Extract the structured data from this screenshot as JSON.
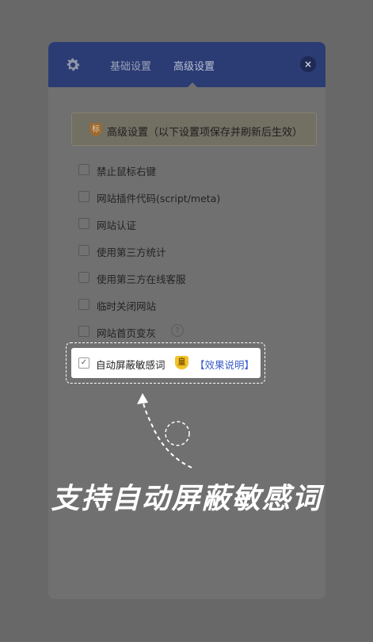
{
  "tabs": [
    {
      "label": "基础设置"
    },
    {
      "label": "高级设置"
    }
  ],
  "close_label": "×",
  "notice": {
    "badge": "标",
    "text": "高级设置（以下设置项保存并刷新后生效）"
  },
  "options": [
    {
      "label": "禁止鼠标右键",
      "checked": false
    },
    {
      "label": "网站插件代码(script/meta)",
      "checked": false
    },
    {
      "label": "网站认证",
      "checked": false
    },
    {
      "label": "使用第三方统计",
      "checked": false
    },
    {
      "label": "使用第三方在线客服",
      "checked": false
    },
    {
      "label": "临时关闭网站",
      "checked": false
    },
    {
      "label": "网站首页变灰",
      "checked": false,
      "help": "?"
    }
  ],
  "highlighted_option": {
    "label": "自动屏蔽敏感词",
    "checked": true,
    "check_mark": "✓",
    "vip_badge": "皇",
    "link": "【效果说明】"
  },
  "caption": "支持自动屏蔽敏感词",
  "colors": {
    "header": "#2b3b73",
    "link": "#3a5cc8",
    "vip": "#f0c22a"
  }
}
